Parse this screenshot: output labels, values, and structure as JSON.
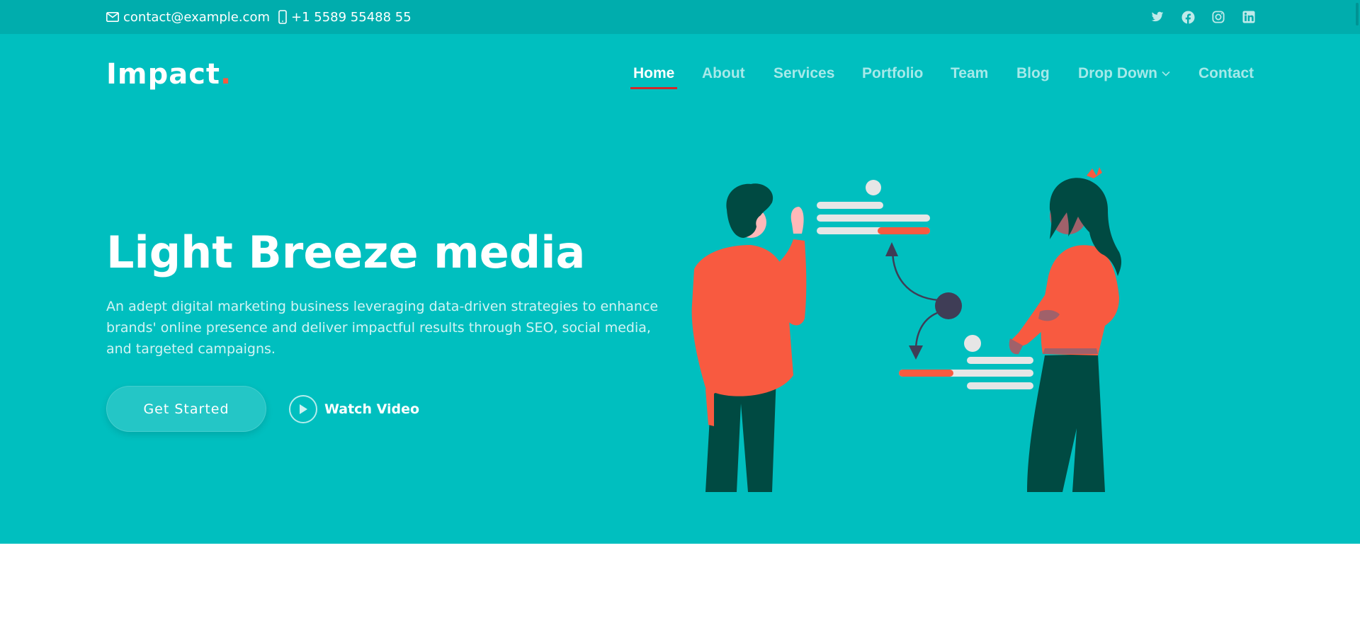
{
  "topbar": {
    "email": "contact@example.com",
    "phone": "+1 5589 55488 55",
    "social": [
      "twitter-icon",
      "facebook-icon",
      "instagram-icon",
      "linkedin-icon"
    ]
  },
  "header": {
    "logo_text": "Impact",
    "logo_dot": ".",
    "nav": [
      {
        "label": "Home",
        "active": true
      },
      {
        "label": "About"
      },
      {
        "label": "Services"
      },
      {
        "label": "Portfolio"
      },
      {
        "label": "Team"
      },
      {
        "label": "Blog"
      },
      {
        "label": "Drop Down"
      },
      {
        "label": "Contact"
      }
    ]
  },
  "hero": {
    "title": "Light Breeze media",
    "description": "An adept digital marketing business leveraging data-driven strategies to enhance brands' online presence and deliver impactful results through SEO, social media, and targeted campaigns.",
    "primary_button": "Get Started",
    "video_button": "Watch Video"
  },
  "colors": {
    "accent": "#00bfbf",
    "topbar": "#00adad",
    "highlight": "#f85a40",
    "active_underline": "#d3272a"
  }
}
